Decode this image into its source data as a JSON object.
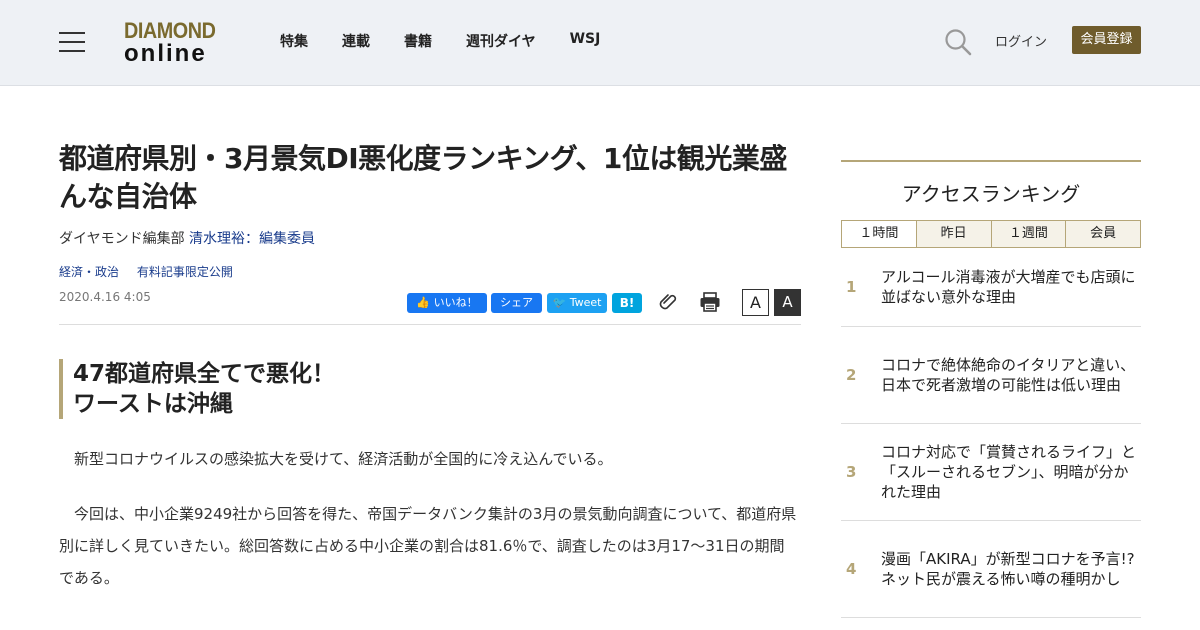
{
  "header": {
    "logo_line1": "DIAMOND",
    "logo_line2": "online",
    "nav": [
      "特集",
      "連載",
      "書籍",
      "週刊ダイヤ",
      "WSJ"
    ],
    "login": "ログイン",
    "register": "会員登録"
  },
  "article": {
    "title": "都道府県別・3月景気DI悪化度ランキング、1位は観光業盛んな自治体",
    "author_prefix": "ダイヤモンド編集部",
    "author_link": "清水理裕：編集委員",
    "tags": [
      "経済・政治",
      "有料記事限定公開"
    ],
    "date": "2020.4.16 4:05",
    "share": {
      "like": "いいね！",
      "share": "シェア",
      "tweet": "Tweet",
      "hatena": "B!"
    },
    "font_small": "A",
    "font_large": "A",
    "subhead_line1": "47都道府県全てで悪化！",
    "subhead_line2": "ワーストは沖縄",
    "paragraphs": [
      "新型コロナウイルスの感染拡大を受けて、経済活動が全国的に冷え込んでいる。",
      "今回は、中小企業9249社から回答を得た、帝国データバンク集計の3月の景気動向調査について、都道府県別に詳しく見ていきたい。総回答数に占める中小企業の割合は81.6％で、調査したのは3月17〜31日の期間である。"
    ]
  },
  "sidebar": {
    "title": "アクセスランキング",
    "tabs": [
      "１時間",
      "昨日",
      "１週間",
      "会員"
    ],
    "items": [
      {
        "rank": "1",
        "text": "アルコール消毒液が大増産でも店頭に並ばない意外な理由"
      },
      {
        "rank": "2",
        "text": "コロナで絶体絶命のイタリアと違い、日本で死者激増の可能性は低い理由"
      },
      {
        "rank": "3",
        "text": "コロナ対応で「賞賛されるライフ」と「スルーされるセブン」、明暗が分かれた理由"
      },
      {
        "rank": "4",
        "text": "漫画「AKIRA」が新型コロナを予言!?ネット民が震える怖い噂の種明かし"
      }
    ]
  }
}
